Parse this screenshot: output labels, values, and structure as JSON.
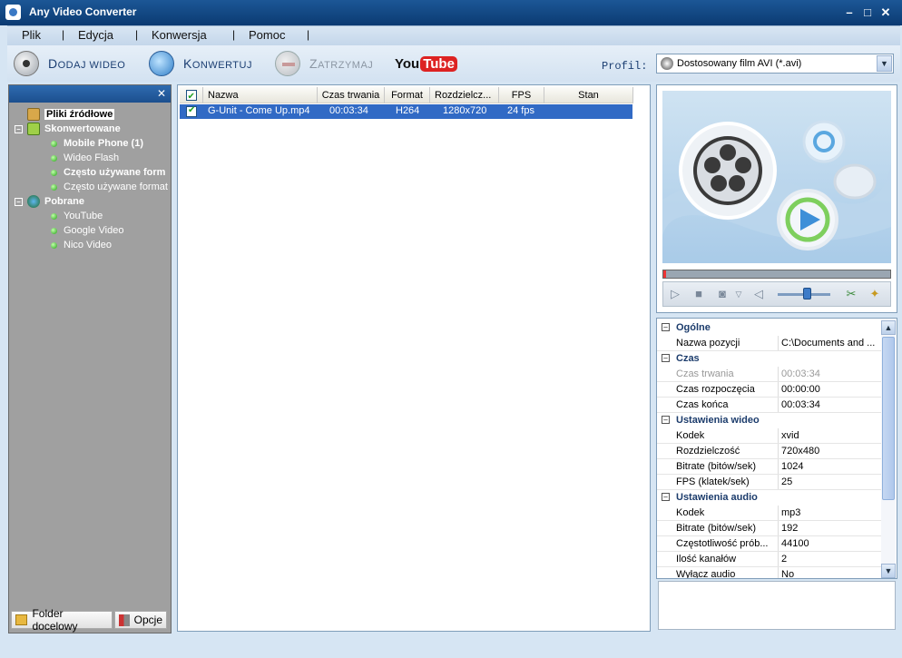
{
  "window": {
    "title": "Any Video Converter",
    "btn_min": "–",
    "btn_max": "□",
    "btn_close": "✕"
  },
  "menu": [
    "Plik",
    "Edycja",
    "Konwersja",
    "Pomoc"
  ],
  "menu_sep": "|",
  "toolbar": {
    "add_video": "Dodaj wideo",
    "convert": "Konwertuj",
    "stop": "Zatrzymaj",
    "youtube_you": "You",
    "youtube_tube": "Tube",
    "profile_label": "Profil:",
    "profile_value": "Dostosowany film AVI (*.avi)"
  },
  "tree": {
    "root": "Pliki źródłowe",
    "converted": "Skonwertowane",
    "converted_items": [
      "Mobile Phone (1)",
      "Wideo Flash",
      "Często używane form",
      "Często używane format"
    ],
    "downloaded": "Pobrane",
    "downloaded_items": [
      "YouTube",
      "Google Video",
      "Nico Video"
    ]
  },
  "leftfooter": {
    "folder": "Folder docelowy",
    "options": "Opcje"
  },
  "list": {
    "headers": [
      "Nazwa",
      "Czas trwania",
      "Format",
      "Rozdzielcz...",
      "FPS",
      "Stan"
    ],
    "rows": [
      {
        "name": "G-Unit - Come Up.mp4",
        "duration": "00:03:34",
        "format": "H264",
        "resolution": "1280x720",
        "fps": "24 fps",
        "status": ""
      }
    ]
  },
  "props": {
    "general": {
      "title": "Ogólne",
      "item_name_k": "Nazwa pozycji",
      "item_name_v": "C:\\Documents and ..."
    },
    "time": {
      "title": "Czas",
      "rows": [
        {
          "k": "Czas trwania",
          "v": "00:03:34"
        },
        {
          "k": "Czas rozpoczęcia",
          "v": "00:00:00"
        },
        {
          "k": "Czas końca",
          "v": "00:03:34"
        }
      ]
    },
    "video": {
      "title": "Ustawienia wideo",
      "rows": [
        {
          "k": "Kodek",
          "v": "xvid"
        },
        {
          "k": "Rozdzielczość",
          "v": "720x480"
        },
        {
          "k": "Bitrate (bitów/sek)",
          "v": "1024"
        },
        {
          "k": "FPS (klatek/sek)",
          "v": "25"
        }
      ]
    },
    "audio": {
      "title": "Ustawienia audio",
      "rows": [
        {
          "k": "Kodek",
          "v": "mp3"
        },
        {
          "k": "Bitrate (bitów/sek)",
          "v": "192"
        },
        {
          "k": "Częstotliwość prób...",
          "v": "44100"
        },
        {
          "k": "Ilość kanałów",
          "v": "2"
        },
        {
          "k": "Wyłącz audio",
          "v": "No"
        }
      ]
    }
  },
  "player": {
    "progress": 0.01,
    "volume": 0.55
  },
  "colors": {
    "accent": "#316ac5",
    "titlebar": "#1c5796",
    "tree_bg": "#a0a0a0"
  }
}
